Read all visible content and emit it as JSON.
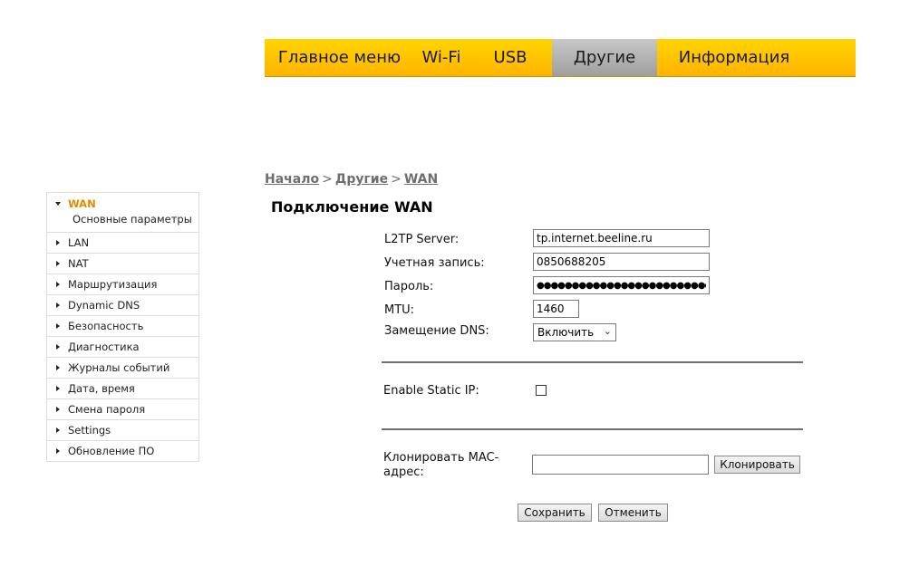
{
  "topnav": {
    "tabs": [
      {
        "label": "Главное меню"
      },
      {
        "label": "Wi-Fi"
      },
      {
        "label": "USB"
      },
      {
        "label": "Другие",
        "active": true
      },
      {
        "label": "Информация"
      }
    ]
  },
  "breadcrumb": {
    "items": [
      "Начало",
      "Другие",
      "WAN"
    ],
    "separator": ">"
  },
  "page_title": "Подключение WAN",
  "sidebar": {
    "expanded": {
      "label": "WAN",
      "sub": "Основные параметры"
    },
    "items": [
      {
        "label": "LAN"
      },
      {
        "label": "NAT"
      },
      {
        "label": "Маршрутизация"
      },
      {
        "label": "Dynamic DNS"
      },
      {
        "label": "Безопасность"
      },
      {
        "label": "Диагностика"
      },
      {
        "label": "Журналы событий"
      },
      {
        "label": "Дата, время"
      },
      {
        "label": "Смена пароля"
      },
      {
        "label": "Settings"
      },
      {
        "label": "Обновление ПО"
      }
    ]
  },
  "form": {
    "l2tp": {
      "label": "L2TP Server:",
      "value": "tp.internet.beeline.ru"
    },
    "account": {
      "label": "Учетная запись:",
      "value": "0850688205"
    },
    "password": {
      "label": "Пароль:",
      "value": "●●●●●●●●●●●●●●●●●●●●●●●●●"
    },
    "mtu": {
      "label": "MTU:",
      "value": "1460"
    },
    "dns": {
      "label": "Замещение DNS:",
      "value": "Включить"
    },
    "static_ip": {
      "label": "Enable Static IP:",
      "checked": false
    },
    "mac": {
      "label_line1": "Клонировать MAC-",
      "label_line2": "адрес:",
      "value": "",
      "clone_button": "Клонировать"
    }
  },
  "actions": {
    "save": "Сохранить",
    "cancel": "Отменить"
  },
  "colors": {
    "nav_yellow": "#ffc800",
    "nav_active": "#aaaaaa",
    "sidebar_active": "#e68a00"
  }
}
